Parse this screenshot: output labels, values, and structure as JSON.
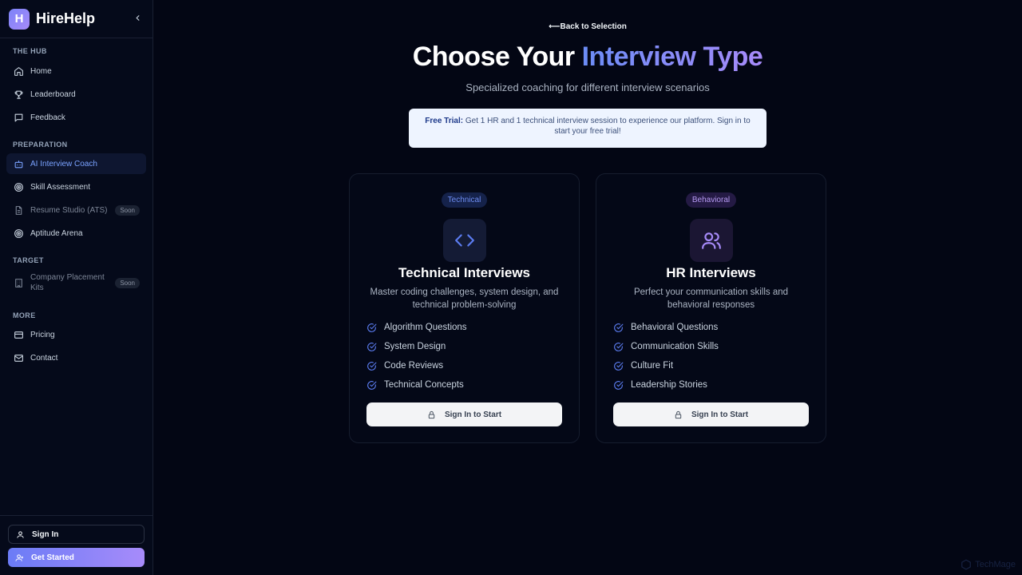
{
  "brand": {
    "logo_letter": "H",
    "name": "HireHelp",
    "collapse_icon": "chevron-left-icon"
  },
  "sidebar": {
    "sections": [
      {
        "title": "THE HUB",
        "items": [
          {
            "label": "Home",
            "icon": "home-icon"
          },
          {
            "label": "Leaderboard",
            "icon": "trophy-icon"
          },
          {
            "label": "Feedback",
            "icon": "message-square-icon"
          }
        ]
      },
      {
        "title": "PREPARATION",
        "items": [
          {
            "label": "AI Interview Coach",
            "icon": "bot-icon",
            "active": true
          },
          {
            "label": "Skill Assessment",
            "icon": "target-icon"
          },
          {
            "label": "Resume Studio (ATS)",
            "icon": "file-text-icon",
            "badge": "Soon"
          },
          {
            "label": "Aptitude Arena",
            "icon": "target-icon"
          }
        ]
      },
      {
        "title": "TARGET",
        "items": [
          {
            "label": "Company Placement Kits",
            "icon": "building-icon",
            "badge": "Soon"
          }
        ]
      },
      {
        "title": "MORE",
        "items": [
          {
            "label": "Pricing",
            "icon": "credit-card-icon"
          },
          {
            "label": "Contact",
            "icon": "mail-icon"
          }
        ]
      }
    ],
    "sign_in_label": "Sign In",
    "get_started_label": "Get Started"
  },
  "main": {
    "back_label": "Back to Selection",
    "back_arrow": "⟵",
    "title_plain": "Choose Your ",
    "title_accent": "Interview Type",
    "subtitle": "Specialized coaching for different interview scenarios",
    "trial": {
      "label": "Free Trial:",
      "text": " Get 1 HR and 1 technical interview session to experience our platform. Sign in to start your free trial!"
    },
    "cards": [
      {
        "tag": "Technical",
        "title": "Technical Interviews",
        "description": "Master coding challenges, system design, and technical problem-solving",
        "features": [
          "Algorithm Questions",
          "System Design",
          "Code Reviews",
          "Technical Concepts"
        ],
        "button_label": "Sign In to Start",
        "icon": "code-icon"
      },
      {
        "tag": "Behavioral",
        "title": "HR Interviews",
        "description": "Perfect your communication skills and behavioral responses",
        "features": [
          "Behavioral Questions",
          "Communication Skills",
          "Culture Fit",
          "Leadership Stories"
        ],
        "button_label": "Sign In to Start",
        "icon": "users-icon"
      }
    ]
  },
  "watermark": "TechMage",
  "colors": {
    "background": "#030614",
    "accent_blue": "#6b8cf6",
    "accent_purple": "#a78bfa",
    "active_nav": "#7aa2ff"
  }
}
